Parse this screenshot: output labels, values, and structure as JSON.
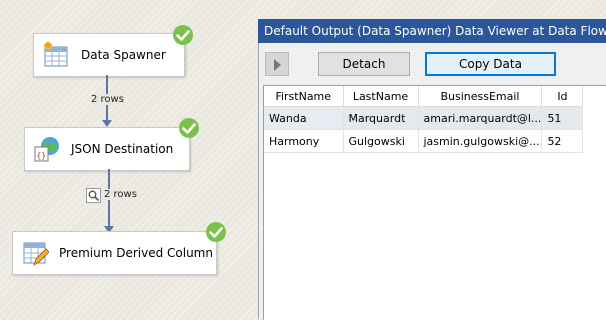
{
  "data_flow": {
    "tasks": [
      {
        "id": "data-spawner",
        "label": "Data Spawner",
        "icon": "table-sparkle-icon",
        "status": "success-check-icon"
      },
      {
        "id": "json-destination",
        "label": "JSON Destination",
        "icon": "json-globe-icon",
        "status": "success-check-icon"
      },
      {
        "id": "premium-derived-column",
        "label": "Premium Derived Column",
        "icon": "table-pencil-icon",
        "status": "success-check-icon"
      }
    ],
    "paths": [
      {
        "label": "2 rows",
        "has_data_viewer": false
      },
      {
        "label": "2 rows",
        "has_data_viewer": true,
        "viewer_icon": "magnifier-icon"
      }
    ]
  },
  "viewer": {
    "title": "Default Output (Data Spawner) Data Viewer at Data Flow Task",
    "toolbar": {
      "detach_label": "Detach",
      "copy_label": "Copy Data",
      "play_icon": "play-icon"
    },
    "columns": [
      "FirstName",
      "LastName",
      "BusinessEmail",
      "Id"
    ],
    "rows": [
      [
        "Wanda",
        "Marquardt",
        "amari.marquardt@l...",
        "51"
      ],
      [
        "Harmony",
        "Gulgowski",
        "jasmin.gulgowski@...",
        "52"
      ]
    ],
    "selected_row": 0
  },
  "colors": {
    "title_bar": "#2b579a",
    "connector": "#5a76a6",
    "success_green": "#7cc14e",
    "focus_border": "#0078d7"
  }
}
